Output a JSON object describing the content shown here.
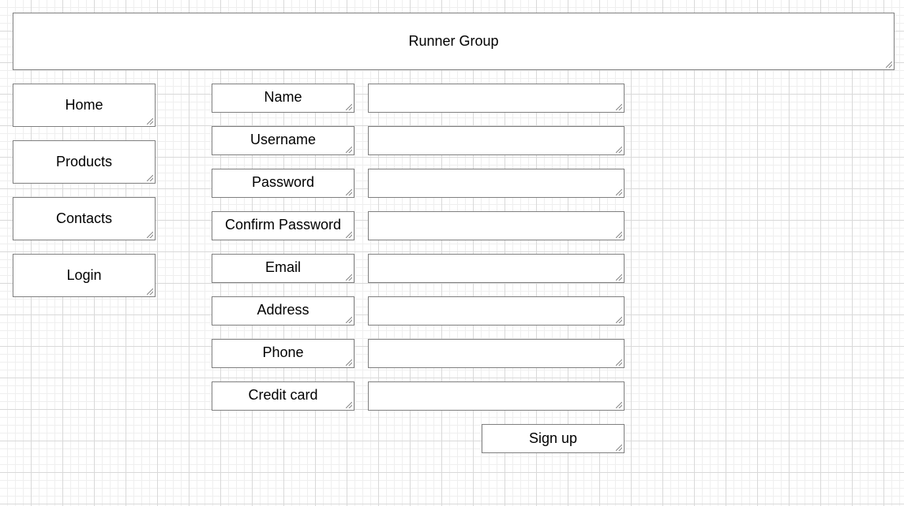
{
  "header": {
    "title": "Runner Group"
  },
  "nav": {
    "items": [
      {
        "label": "Home"
      },
      {
        "label": "Products"
      },
      {
        "label": "Contacts"
      },
      {
        "label": "Login"
      }
    ]
  },
  "form": {
    "fields": [
      {
        "label": "Name",
        "value": ""
      },
      {
        "label": "Username",
        "value": ""
      },
      {
        "label": "Password",
        "value": ""
      },
      {
        "label": "Confirm Password",
        "value": ""
      },
      {
        "label": "Email",
        "value": ""
      },
      {
        "label": "Address",
        "value": ""
      },
      {
        "label": "Phone",
        "value": ""
      },
      {
        "label": "Credit card",
        "value": ""
      }
    ],
    "submit_label": "Sign up"
  }
}
